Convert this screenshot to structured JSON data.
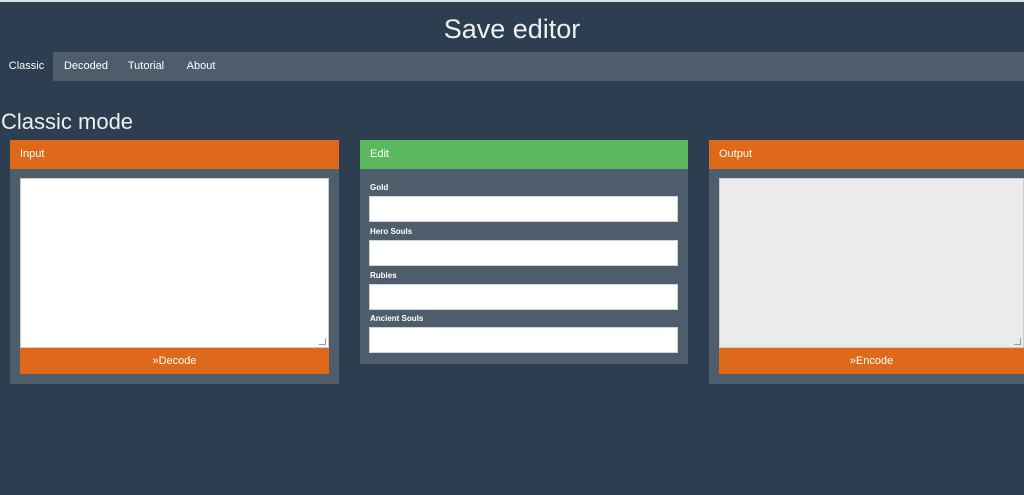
{
  "app": {
    "title": "Save editor"
  },
  "nav": {
    "tabs": [
      {
        "label": "Classic",
        "active": true
      },
      {
        "label": "Decoded",
        "active": false
      },
      {
        "label": "Tutorial",
        "active": false
      },
      {
        "label": "About",
        "active": false
      }
    ]
  },
  "main": {
    "section_title": "Classic mode",
    "input_panel": {
      "heading": "Input",
      "input_value": "",
      "button_label": "Decode",
      "button_icon": "double-chevron-right-icon"
    },
    "edit_panel": {
      "heading": "Edit",
      "fields": [
        {
          "label": "Gold",
          "value": ""
        },
        {
          "label": "Hero Souls",
          "value": ""
        },
        {
          "label": "Rubies",
          "value": ""
        },
        {
          "label": "Ancient Souls",
          "value": ""
        }
      ]
    },
    "output_panel": {
      "heading": "Output",
      "output_value": "",
      "button_label": "Encode",
      "button_icon": "double-chevron-right-icon"
    }
  },
  "colors": {
    "background": "#2c3e50",
    "navbar": "#4e5d6c",
    "accent_orange": "#df691a",
    "accent_green": "#5cb85c"
  }
}
